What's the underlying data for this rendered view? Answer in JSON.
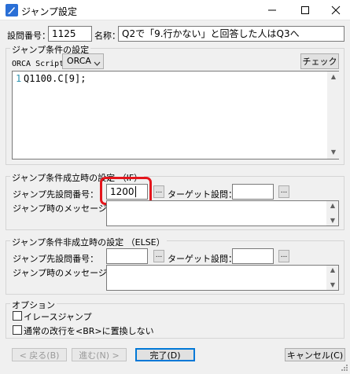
{
  "window": {
    "title": "ジャンプ設定",
    "minimize_icon": "minimize-icon",
    "maximize_icon": "maximize-icon",
    "close_icon": "close-icon"
  },
  "header": {
    "question_no_label": "設問番号：",
    "question_no_value": "1125",
    "name_label": "名称：",
    "name_value": "Q2で「9.行かない」と回答した人はQ3へ"
  },
  "condition": {
    "legend": "ジャンプ条件の設定",
    "script_label": "ORCA Script：",
    "script_value": "ORCA",
    "check_button": "チェック",
    "line_number": "1",
    "code": "Q1100.C[9];"
  },
  "then_group": {
    "legend": "ジャンプ条件成立時の設定 （IF）",
    "jump_dest_label": "ジャンプ先設問番号：",
    "jump_dest_value": "1200",
    "target_label": "ターゲット設問：",
    "target_value": "",
    "message_label": "ジャンプ時のメッセージ：",
    "message_value": "",
    "ellipsis": "..."
  },
  "else_group": {
    "legend": "ジャンプ条件非成立時の設定 （ELSE）",
    "jump_dest_label": "ジャンプ先設問番号：",
    "jump_dest_value": "",
    "target_label": "ターゲット設問：",
    "target_value": "",
    "message_label": "ジャンプ時のメッセージ：",
    "message_value": "",
    "ellipsis": "..."
  },
  "options": {
    "legend": "オプション",
    "erase_jump_label": "イレースジャンプ",
    "no_br_label": "通常の改行を<BR>に置換しない"
  },
  "footer": {
    "back_button": "< 戻る(B)",
    "next_button": "進む(N) >",
    "finish_button": "完了(D)",
    "cancel_button": "キャンセル(C)"
  },
  "colors": {
    "highlight": "#e4151c",
    "accent": "#0078d7"
  }
}
